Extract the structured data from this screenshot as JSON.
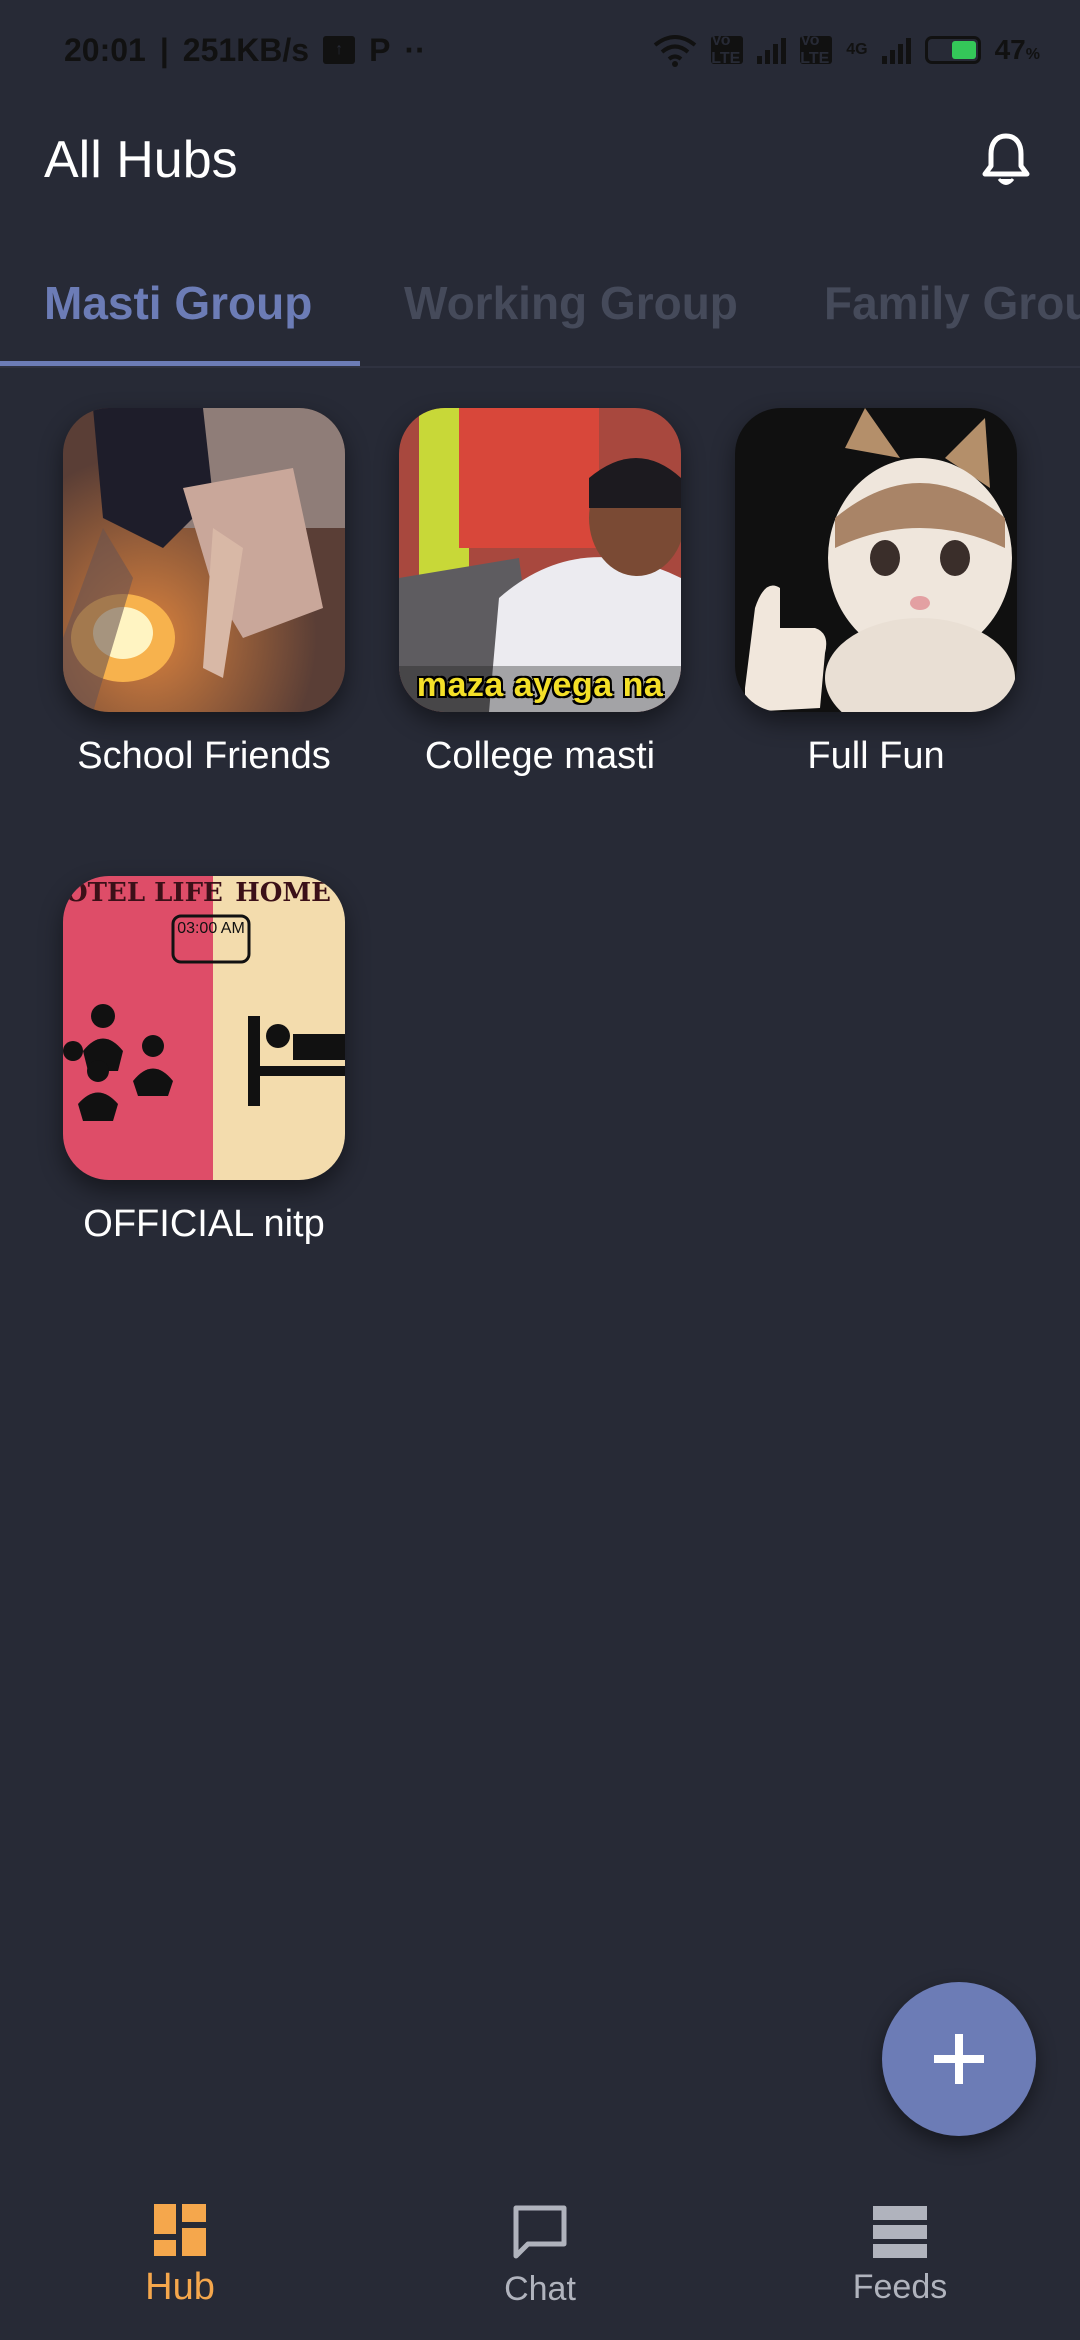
{
  "status_bar": {
    "time": "20:01",
    "speed": "251KB/s",
    "battery": "47",
    "battery_unit": "%",
    "volte1": "Vo LTE",
    "volte2": "Vo LTE",
    "network": "4G",
    "icons": [
      "upload-icon",
      "parking-app-icon",
      "more-dots-icon",
      "wifi-icon",
      "signal-icon",
      "battery-charging-icon"
    ]
  },
  "app_bar": {
    "title": "All Hubs",
    "notification_icon": "bell-icon"
  },
  "tabs": [
    {
      "label": "Masti Group",
      "active": true
    },
    {
      "label": "Working Group",
      "active": false
    },
    {
      "label": "Family Grou",
      "active": false
    }
  ],
  "hubs": [
    {
      "label": "School Friends"
    },
    {
      "label": "College masti",
      "image_caption": "maza ayega na"
    },
    {
      "label": "Full Fun"
    },
    {
      "label": "OFFICIAL nitp",
      "image_text_left": "OTEL LIFE",
      "image_text_right": "HOME",
      "image_clock": "03:00 AM"
    }
  ],
  "fab": {
    "icon": "plus-icon"
  },
  "bottom_nav": [
    {
      "label": "Hub",
      "icon": "dashboard-icon",
      "active": true
    },
    {
      "label": "Chat",
      "icon": "chat-bubble-icon",
      "active": false
    },
    {
      "label": "Feeds",
      "icon": "feeds-list-icon",
      "active": false
    }
  ],
  "colors": {
    "background": "#272a36",
    "accent": "#6c7cb6",
    "active_nav": "#f5a74c",
    "inactive_tab": "#454a5a"
  }
}
